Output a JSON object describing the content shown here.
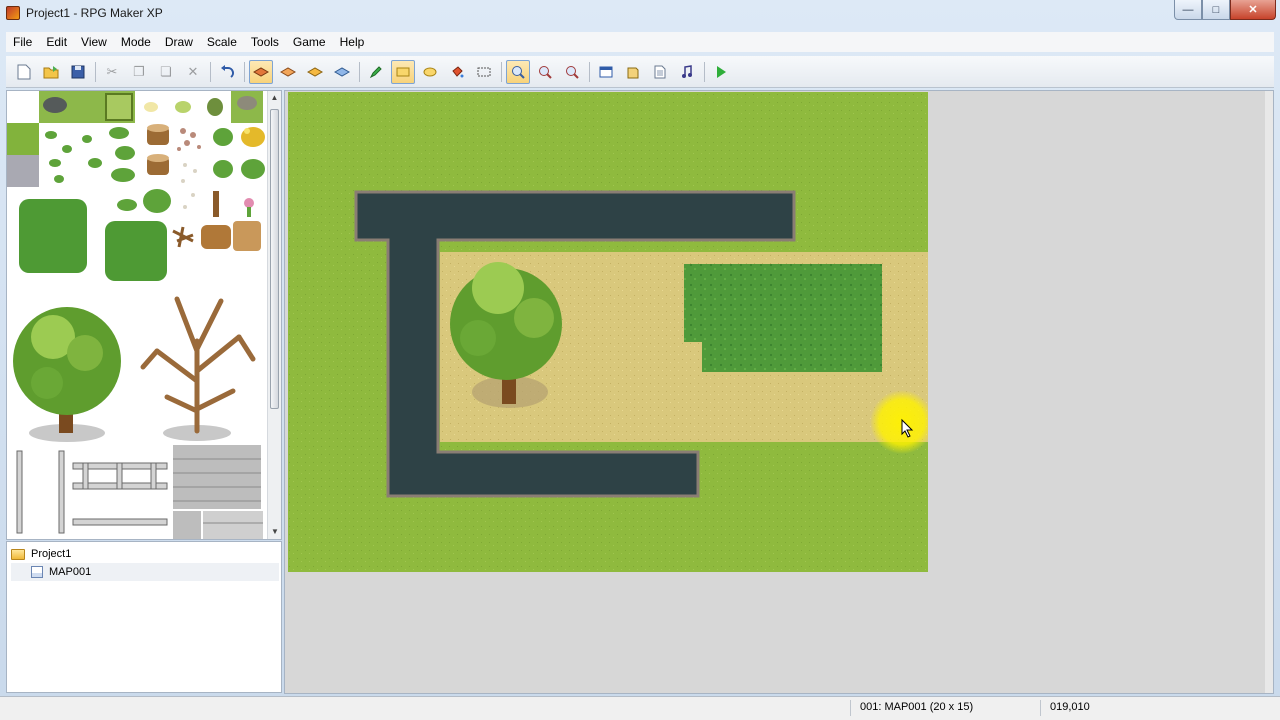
{
  "window": {
    "title": "Project1 - RPG Maker XP"
  },
  "menu": [
    "File",
    "Edit",
    "View",
    "Mode",
    "Draw",
    "Scale",
    "Tools",
    "Game",
    "Help"
  ],
  "toolbar": {
    "new": "new-project-icon",
    "open": "open-project-icon",
    "save": "save-icon",
    "cut": "cut-icon",
    "copy": "copy-icon",
    "paste": "paste-icon",
    "delete": "delete-icon",
    "undo": "undo-icon",
    "layer1": "layer1-icon",
    "layer2": "layer2-icon",
    "layer3": "layer3-icon",
    "events": "events-layer-icon",
    "pencil": "pencil-icon",
    "rectangle": "rectangle-icon",
    "ellipse": "ellipse-icon",
    "fill": "fill-icon",
    "select": "select-icon",
    "zoom11": "zoom-1-1-icon",
    "zoom12": "zoom-1-2-icon",
    "zoom14": "zoom-1-4-icon",
    "database": "database-icon",
    "materialbase": "materialbase-icon",
    "scripteditor": "script-editor-icon",
    "soundtest": "sound-test-icon",
    "playtest": "playtest-icon"
  },
  "tree": {
    "project": "Project1",
    "maps": [
      "MAP001"
    ]
  },
  "status": {
    "map": "001: MAP001 (20 x 15)",
    "coord": "019,010"
  },
  "colors": {
    "grass": "#8fba3e",
    "water": "#2e4246",
    "path": "#d9c87c",
    "bush": "#4f9a3a",
    "highlight": "#fff200"
  }
}
